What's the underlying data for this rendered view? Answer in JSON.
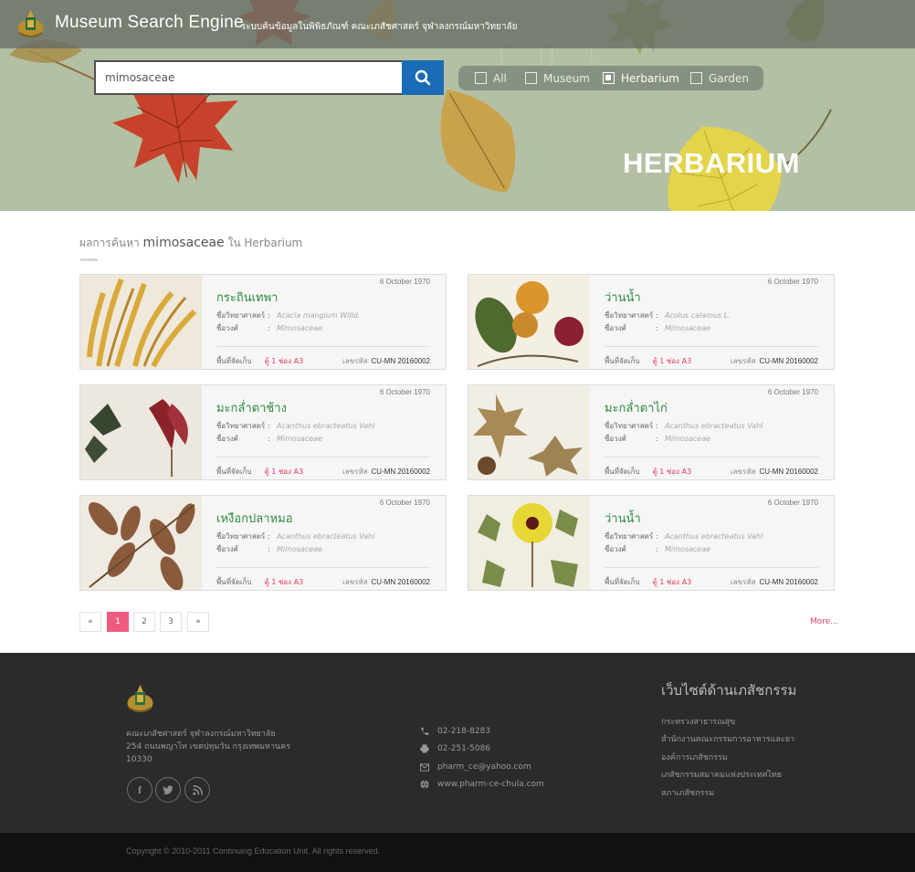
{
  "header": {
    "app_title": "Museum Search Engine",
    "subtitle": "- ระบบค้นข้อมูลในพิพิธภัณฑ์ คณะเภสัชศาสตร์ จุฬาลงกรณ์มหาวิทยาลัย"
  },
  "search": {
    "value": "mimosaceae",
    "button_icon": "search-icon"
  },
  "filters": [
    {
      "label": "All",
      "checked": false
    },
    {
      "label": "Museum",
      "checked": false
    },
    {
      "label": "Herbarium",
      "checked": true
    },
    {
      "label": "Garden",
      "checked": false
    }
  ],
  "hero": {
    "heading": "HERBARIUM"
  },
  "results": {
    "prefix": "ผลการค้นหา",
    "keyword": "mimosaceae",
    "suffix": "ใน Herbarium",
    "sci_label": "ชื่อวิทยาศาสตร์",
    "family_label": "ชื่อวงศ์",
    "location_label": "พื้นที่จัดเก็บ",
    "code_label": "เลขรหัส",
    "items": [
      {
        "date": "6 October  1970",
        "name": "กระถินเทพา",
        "sci_name": "Acacia mangium Willd.",
        "family": "Mimosaceae",
        "location": "ตู้ 1 ช่อง A3",
        "code": "CU-MN 20160002"
      },
      {
        "date": "6 October  1970",
        "name": "ว่านน้ำ",
        "sci_name": "Acolus calamus L.",
        "family": "Mimosaceae",
        "location": "ตู้ 1 ช่อง A3",
        "code": "CU-MN 20160002"
      },
      {
        "date": "6 October  1970",
        "name": "มะกล่ำตาช้าง",
        "sci_name": "Acanthus ebracteatus Vahl",
        "family": "Mimosaceae",
        "location": "ตู้ 1 ช่อง A3",
        "code": "CU-MN 20160002"
      },
      {
        "date": "6 October  1970",
        "name": "มะกล่ำตาไก่",
        "sci_name": "Acanthus ebracteatus Vahl",
        "family": "Mimosaceae",
        "location": "ตู้ 1 ช่อง A3",
        "code": "CU-MN 20160002"
      },
      {
        "date": "6 October  1970",
        "name": "เหงือกปลาหมอ",
        "sci_name": "Acanthus ebracteatus Vahl",
        "family": "Mimosaceae",
        "location": "ตู้ 1 ช่อง A3",
        "code": "CU-MN 20160002"
      },
      {
        "date": "6 October  1970",
        "name": "ว่านน้ำ",
        "sci_name": "Acanthus ebracteatus Vahl",
        "family": "Mimosaceae",
        "location": "ตู้ 1 ช่อง A3",
        "code": "CU-MN 20160002"
      }
    ]
  },
  "pagination": {
    "prev": "«",
    "pages": [
      "1",
      "2",
      "3"
    ],
    "current": "1",
    "next": "»",
    "more": "More..."
  },
  "footer": {
    "address_lines": [
      "คณะเภสัชศาสตร์ จุฬาลงกรณ์มหาวิทยาลัย",
      "254 ถนนพญาไท เขตปทุมวัน กรุงเทพมหานคร",
      "10330"
    ],
    "social": [
      {
        "icon": "facebook-icon",
        "glyph": "f"
      },
      {
        "icon": "twitter-icon",
        "glyph": "t"
      },
      {
        "icon": "rss-icon",
        "glyph": "rss"
      }
    ],
    "contacts": [
      {
        "icon": "phone-icon",
        "text": "02-218-8283"
      },
      {
        "icon": "fax-icon",
        "text": "02-251-5086"
      },
      {
        "icon": "email-icon",
        "text": "pharm_ce@yahoo.com"
      },
      {
        "icon": "globe-icon",
        "text": "www.pharm-ce-chula.com"
      }
    ],
    "links_title": "เว็บไซต์ด้านเภสัชกรรม",
    "links": [
      "กระทรวงสาธารณสุข",
      "สำนักงานคณะกรรมการอาหารและยา",
      "องค์การเภสัชกรรม",
      "เภสัชกรรมสมาคมแห่งประเทศไทย",
      "สภาเภสัชกรรม"
    ],
    "copyright": "Copyright © 2010-2011 Continuing Education Unit. All rights reserved."
  },
  "colors": {
    "accent_blue": "#1a6cb6",
    "name_green": "#2d8a3e",
    "location_red": "#e23b5a",
    "page_active": "#ef5b7f"
  }
}
